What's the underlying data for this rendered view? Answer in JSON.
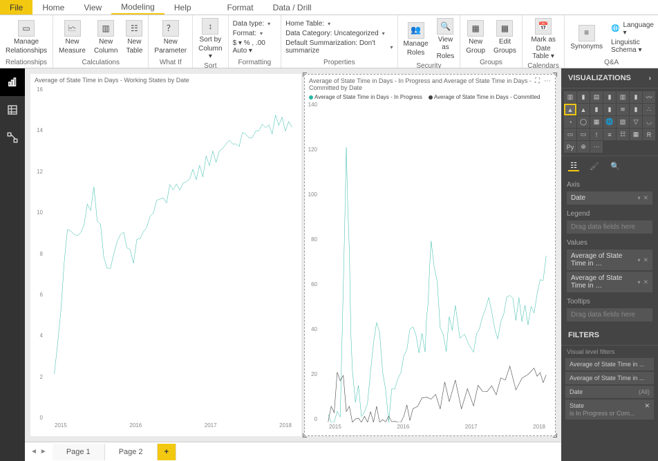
{
  "menu": {
    "file": "File",
    "tabs": [
      "Home",
      "View",
      "Modeling",
      "Help",
      "Format",
      "Data / Drill"
    ],
    "active": 2
  },
  "ribbon": {
    "groups": [
      {
        "label": "Relationships",
        "buttons": [
          {
            "name": "manage-relationships",
            "line1": "Manage",
            "line2": "Relationships"
          }
        ]
      },
      {
        "label": "Calculations",
        "buttons": [
          {
            "name": "new-measure",
            "line1": "New",
            "line2": "Measure"
          },
          {
            "name": "new-column",
            "line1": "New",
            "line2": "Column"
          },
          {
            "name": "new-table",
            "line1": "New",
            "line2": "Table"
          }
        ]
      },
      {
        "label": "What If",
        "buttons": [
          {
            "name": "new-parameter",
            "line1": "New",
            "line2": "Parameter"
          }
        ]
      },
      {
        "label": "Sort",
        "buttons": [
          {
            "name": "sort-by-column",
            "line1": "Sort by",
            "line2": "Column ▾"
          }
        ]
      },
      {
        "label": "Formatting",
        "form": [
          {
            "name": "data-type",
            "label": "Data type:",
            "dd": true
          },
          {
            "name": "format",
            "label": "Format:",
            "dd": true
          },
          {
            "name": "format-tools",
            "label": "$ ▾  %  ,  .00  Auto ▾"
          }
        ]
      },
      {
        "label": "Properties",
        "form": [
          {
            "name": "home-table",
            "label": "Home Table:",
            "dd": true
          },
          {
            "name": "data-category",
            "label": "Data Category: Uncategorized",
            "dd": true
          },
          {
            "name": "default-summarization",
            "label": "Default Summarization: Don't summarize",
            "dd": true
          }
        ]
      },
      {
        "label": "Security",
        "buttons": [
          {
            "name": "manage-roles",
            "line1": "Manage",
            "line2": "Roles"
          },
          {
            "name": "view-as-roles",
            "line1": "View as",
            "line2": "Roles"
          }
        ]
      },
      {
        "label": "Groups",
        "buttons": [
          {
            "name": "new-group",
            "line1": "New",
            "line2": "Group"
          },
          {
            "name": "edit-groups",
            "line1": "Edit",
            "line2": "Groups"
          }
        ]
      },
      {
        "label": "Calendars",
        "buttons": [
          {
            "name": "mark-date-table",
            "line1": "Mark as",
            "line2": "Date Table ▾"
          }
        ]
      },
      {
        "label": "Q&A",
        "buttons": [
          {
            "name": "synonyms",
            "line1": "Synonyms",
            "line2": ""
          }
        ],
        "extras": [
          "Language ▾",
          "Linguistic Schema ▾"
        ]
      }
    ]
  },
  "leftnav": [
    "report",
    "data",
    "model"
  ],
  "visuals": {
    "left": {
      "title": "Average of State Time in Days - Working States by Date",
      "yticks": [
        "16",
        "14",
        "12",
        "10",
        "8",
        "6",
        "4",
        "2",
        "0"
      ],
      "xticks": [
        "2015",
        "2016",
        "2017",
        "2018"
      ]
    },
    "right": {
      "title": "Average of State Time in Days - In Progress and Average of State Time in Days - Committed by Date",
      "legend": [
        {
          "label": "Average of State Time in Days - In Progress",
          "color": "#2ab8a6"
        },
        {
          "label": "Average of State Time in Days - Committed",
          "color": "#444"
        }
      ],
      "yticks": [
        "140",
        "120",
        "100",
        "80",
        "60",
        "40",
        "20",
        "0"
      ],
      "xticks": [
        "2015",
        "2016",
        "2017",
        "2018"
      ]
    }
  },
  "chart_data": [
    {
      "type": "line",
      "title": "Average of State Time in Days - Working States by Date",
      "xlabel": "Date",
      "ylabel": "",
      "ylim": [
        0,
        16
      ],
      "series": [
        {
          "name": "Average of State Time in Days - Working States",
          "x_years": [
            2014.6,
            2014.8,
            2015.0,
            2015.2,
            2015.4,
            2015.6,
            2015.8,
            2016.0,
            2016.2,
            2016.4,
            2016.6,
            2016.8,
            2017.0,
            2017.2,
            2017.4,
            2017.6,
            2017.8,
            2018.0,
            2018.2
          ],
          "values": [
            2.0,
            9.0,
            9.0,
            11.0,
            7.0,
            9.0,
            8.0,
            9.5,
            10.5,
            11.0,
            11.5,
            12.0,
            12.5,
            13.2,
            13.5,
            13.8,
            14.0,
            14.2,
            14.2
          ]
        }
      ]
    },
    {
      "type": "line",
      "title": "Average of State Time in Days - In Progress and Average of State Time in Days - Committed by Date",
      "xlabel": "Date",
      "ylabel": "",
      "ylim": [
        0,
        140
      ],
      "series": [
        {
          "name": "Average of State Time in Days - In Progress",
          "x_years": [
            2014.6,
            2014.8,
            2014.9,
            2015.0,
            2015.2,
            2015.4,
            2015.6,
            2015.8,
            2016.0,
            2016.2,
            2016.3,
            2016.5,
            2016.7,
            2017.0,
            2017.2,
            2017.4,
            2017.6,
            2017.8,
            2018.0,
            2018.2
          ],
          "values": [
            0,
            0,
            120,
            20,
            0,
            45,
            5,
            25,
            40,
            30,
            80,
            35,
            45,
            30,
            55,
            40,
            55,
            45,
            50,
            70
          ]
        },
        {
          "name": "Average of State Time in Days - Committed",
          "x_years": [
            2014.6,
            2014.8,
            2015.0,
            2015.2,
            2015.4,
            2015.6,
            2015.8,
            2016.0,
            2016.3,
            2016.6,
            2017.0,
            2017.3,
            2017.6,
            2018.0,
            2018.2
          ],
          "values": [
            0,
            20,
            0,
            0,
            0,
            0,
            0,
            8,
            10,
            12,
            12,
            15,
            18,
            20,
            22
          ]
        }
      ]
    }
  ],
  "pages": {
    "tabs": [
      "Page 1",
      "Page 2"
    ],
    "active": 0
  },
  "vizpane": {
    "header": "VISUALIZATIONS",
    "axis_label": "Axis",
    "axis_item": "Date",
    "legend_label": "Legend",
    "legend_placeholder": "Drag data fields here",
    "values_label": "Values",
    "values_items": [
      "Average of State Time in …",
      "Average of State Time in …"
    ],
    "tooltips_label": "Tooltips",
    "tooltips_placeholder": "Drag data fields here"
  },
  "filterspane": {
    "header": "FILTERS",
    "section": "Visual level filters",
    "items": [
      {
        "label": "Average of State Time in ..."
      },
      {
        "label": "Average of State Time in ..."
      },
      {
        "label": "Date",
        "sub": "(All)"
      },
      {
        "label": "State",
        "sub2": "is In Progress or Com...",
        "x": true
      }
    ]
  }
}
